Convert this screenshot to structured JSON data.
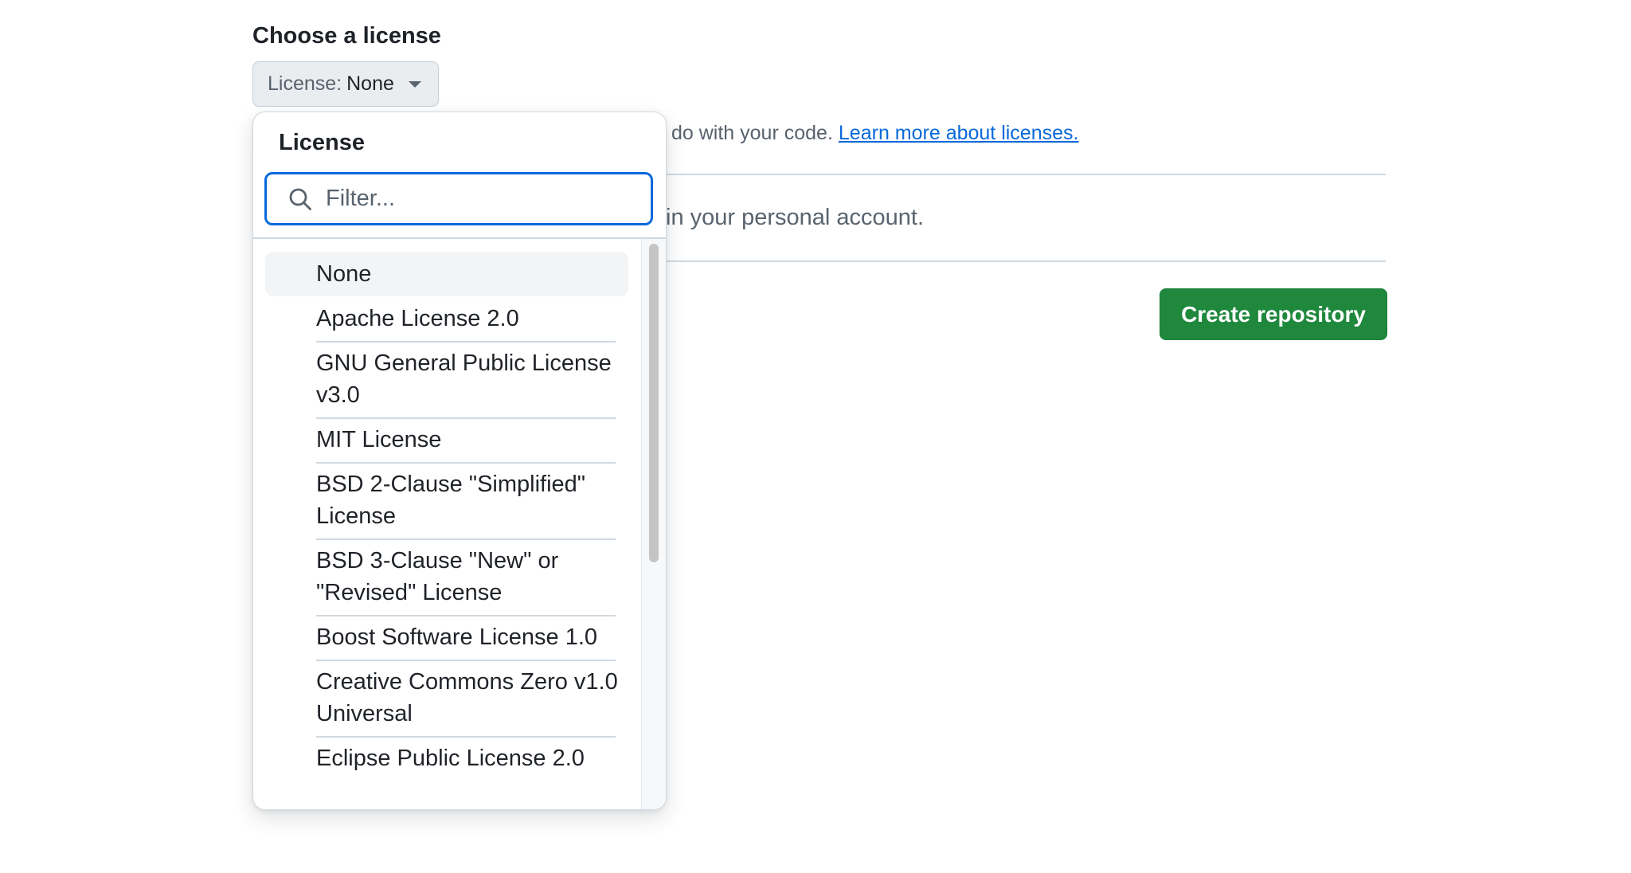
{
  "section": {
    "heading": "Choose a license"
  },
  "license_button": {
    "prefix": "License:",
    "value": "None"
  },
  "help": {
    "text": "do with your code.",
    "link": "Learn more about licenses."
  },
  "account_text": "in your personal account.",
  "create_button": {
    "label": "Create repository"
  },
  "dropdown": {
    "title": "License",
    "filter_placeholder": "Filter...",
    "options": [
      {
        "label": "None",
        "highlighted": true
      },
      {
        "label": "Apache License 2.0"
      },
      {
        "label": "GNU General Public License v3.0"
      },
      {
        "label": "MIT License"
      },
      {
        "label": "BSD 2-Clause \"Simplified\" License"
      },
      {
        "label": "BSD 3-Clause \"New\" or \"Revised\" License"
      },
      {
        "label": "Boost Software License 1.0"
      },
      {
        "label": "Creative Commons Zero v1.0 Universal"
      },
      {
        "label": "Eclipse Public License 2.0"
      }
    ]
  },
  "colors": {
    "accent": "#0969da",
    "primary_button": "#1f883d",
    "text": "#1f2328",
    "muted": "#59636e",
    "border": "#d1d9e0"
  }
}
